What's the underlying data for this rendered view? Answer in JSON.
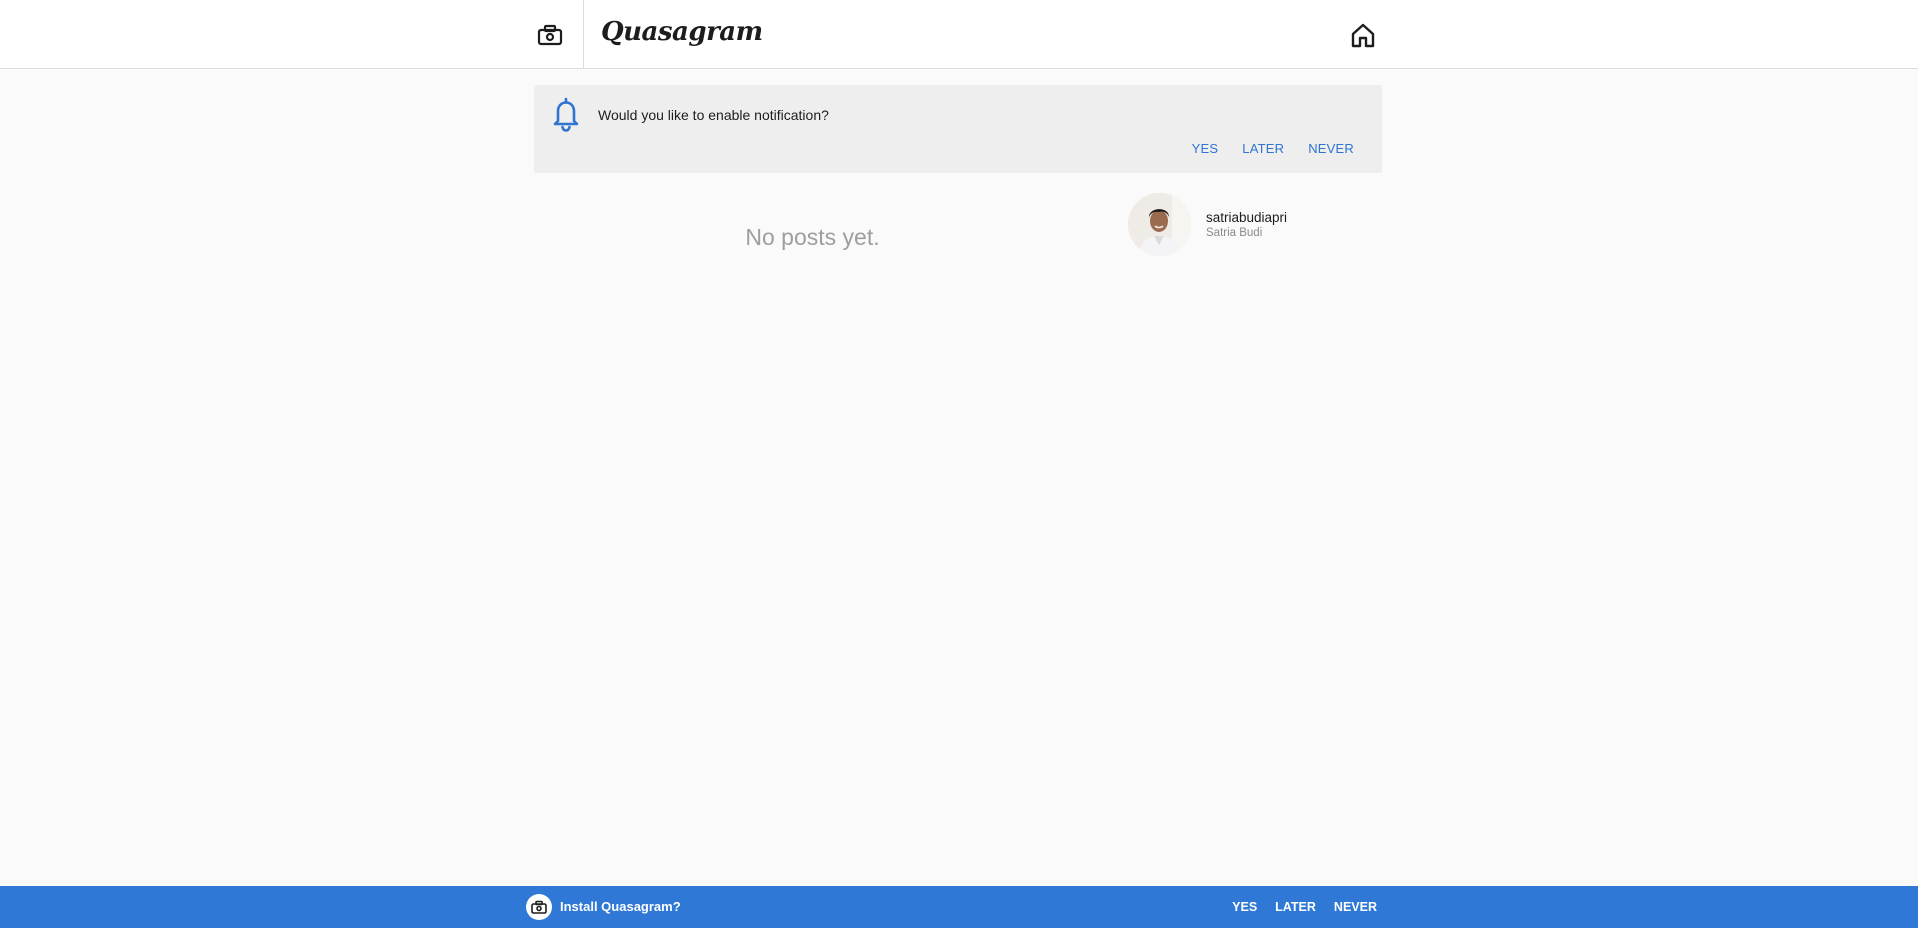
{
  "header": {
    "brand": "Quasagram",
    "camera_icon": "camera-icon",
    "home_icon": "home-icon"
  },
  "notification": {
    "icon": "bell-icon",
    "message": "Would you like to enable notification?",
    "actions": [
      "YES",
      "LATER",
      "NEVER"
    ]
  },
  "feed": {
    "empty_message": "No posts yet."
  },
  "profile": {
    "username": "satriabudiapri",
    "full_name": "Satria Budi"
  },
  "install_banner": {
    "icon": "camera-icon",
    "message": "Install Quasagram?",
    "actions": [
      "YES",
      "LATER",
      "NEVER"
    ]
  },
  "colors": {
    "accent": "#2f78d6",
    "link": "#2f74d0",
    "notification_bg": "#eeeeee",
    "page_bg": "#fafafa"
  }
}
